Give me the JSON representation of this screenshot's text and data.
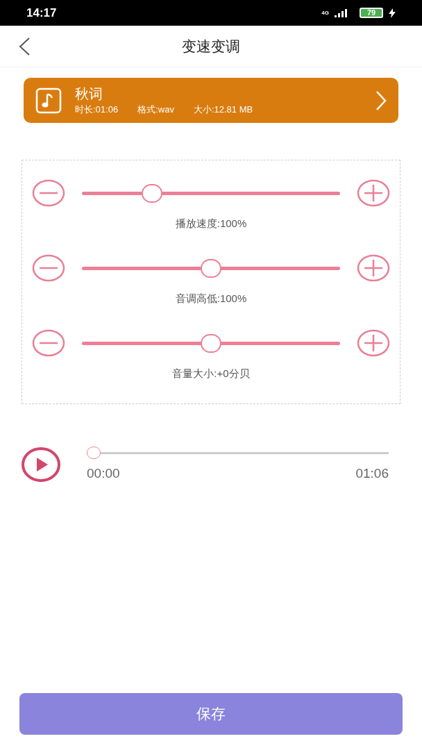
{
  "status_bar": {
    "time": "14:17",
    "network": "4G",
    "battery": "79"
  },
  "header": {
    "title": "变速变调"
  },
  "file_card": {
    "name": "秋词",
    "duration": "时长:01:06",
    "format": "格式:wav",
    "size": "大小:12.81 MB"
  },
  "sliders": [
    {
      "label": "播放速度:100%",
      "level": 0.25
    },
    {
      "label": "音调高低:100%",
      "level": 0.5
    },
    {
      "label": "音量大小:+0分贝",
      "level": 0.5
    }
  ],
  "player": {
    "level": 0,
    "current": "00:00",
    "total": "01:06"
  },
  "save_button": {
    "label": "保存"
  }
}
